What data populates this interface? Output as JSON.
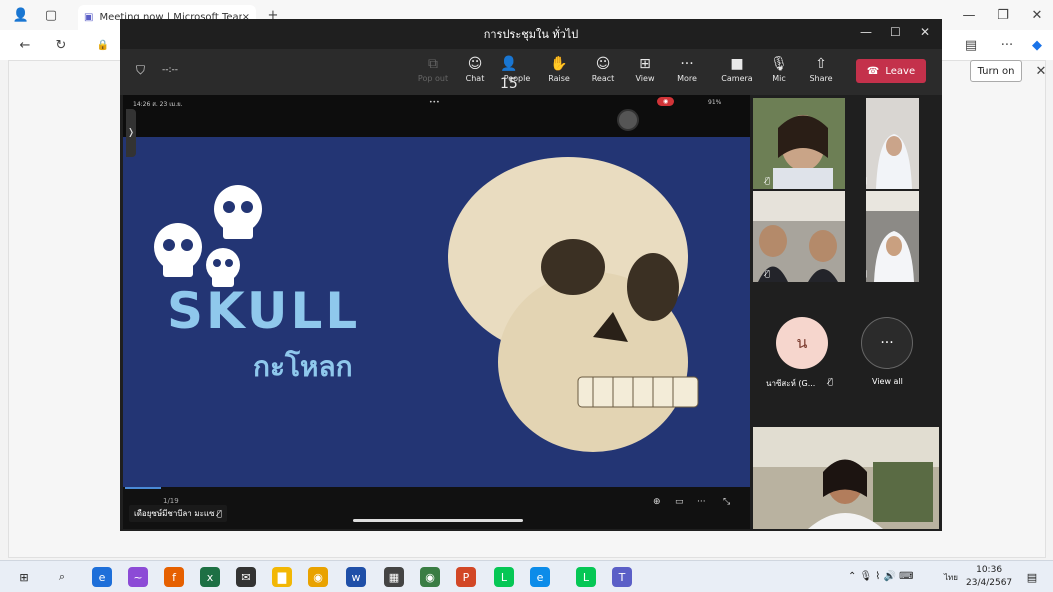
{
  "browser": {
    "tab_title": "Meeting now | Microsoft Teams",
    "close_tab": "×",
    "new_tab": "+",
    "turn_on_label": "Turn on",
    "more": "···"
  },
  "teams": {
    "window_title": "การประชุมใน ทั่วไป",
    "timer": "--:--",
    "toolbar": [
      {
        "key": "popout",
        "icon": "popout-icon",
        "glyph": "⧉",
        "label": "Pop out",
        "dim": true
      },
      {
        "key": "chat",
        "icon": "chat-icon",
        "glyph": "☺",
        "label": "Chat"
      },
      {
        "key": "people",
        "icon": "people-icon",
        "glyph": "👤15",
        "label": "People"
      },
      {
        "key": "raise",
        "icon": "raise-hand-icon",
        "glyph": "✋",
        "label": "Raise"
      },
      {
        "key": "react",
        "icon": "react-icon",
        "glyph": "☺",
        "label": "React"
      },
      {
        "key": "view",
        "icon": "view-icon",
        "glyph": "⊞",
        "label": "View"
      },
      {
        "key": "more",
        "icon": "more-icon",
        "glyph": "···",
        "label": "More"
      },
      {
        "key": "camera",
        "icon": "camera-icon",
        "glyph": "■",
        "label": "Camera"
      },
      {
        "key": "mic",
        "icon": "mic-icon",
        "glyph": "🎙",
        "label": "Mic"
      },
      {
        "key": "share",
        "icon": "share-icon",
        "glyph": "⇧",
        "label": "Share"
      }
    ],
    "leave_label": "Leave",
    "slide": {
      "status_time": "14:26  ส. 23 เม.ย.",
      "status_battery": "91%",
      "status_dots": "•••",
      "title_en": "SKULL",
      "title_th": "กะโหลก",
      "page": "1/19",
      "presenter": "เดือยุซษ์มีชาบีลา มะแซ"
    },
    "participants": {
      "avatar_initial": "น",
      "avatar_name": "นาซีสะห์ (G...",
      "view_all_label": "View all",
      "view_all_glyph": "···"
    }
  },
  "taskbar": {
    "time": "10:36",
    "date": "23/4/2567",
    "lang": "ไทย"
  }
}
